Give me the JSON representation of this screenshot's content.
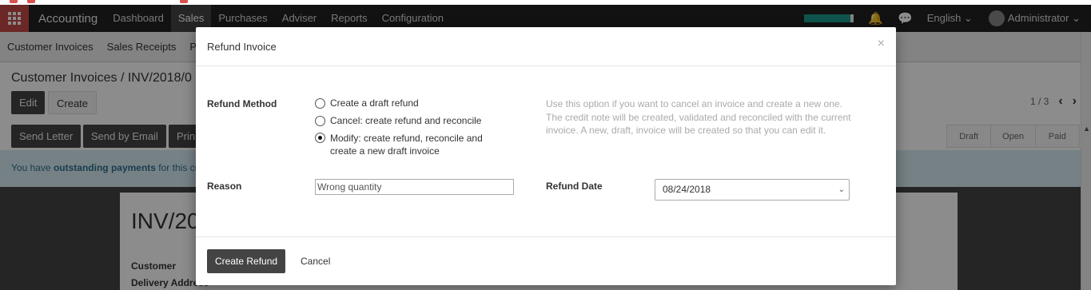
{
  "navbar": {
    "brand": "Accounting",
    "items": [
      "Dashboard",
      "Sales",
      "Purchases",
      "Adviser",
      "Reports",
      "Configuration"
    ],
    "active": "Sales",
    "language": "English",
    "user": "Administrator"
  },
  "subnav": {
    "items": [
      "Customer Invoices",
      "Sales Receipts",
      "Pa"
    ]
  },
  "control_panel": {
    "breadcrumb": "Customer Invoices / INV/2018/0",
    "edit_label": "Edit",
    "create_label": "Create",
    "pager": "1 / 3"
  },
  "actions": {
    "send_letter": "Send Letter",
    "send_email": "Send by Email",
    "print": "Prin"
  },
  "status": [
    "Draft",
    "Open",
    "Paid"
  ],
  "alert": {
    "prefix": "You have ",
    "strong": "outstanding payments",
    "suffix": " for this cu"
  },
  "sheet": {
    "title": "INV/20",
    "customer_label": "Customer",
    "delivery_label": "Delivery Address"
  },
  "modal": {
    "title": "Refund Invoice",
    "close": "×",
    "refund_method_label": "Refund Method",
    "options": [
      {
        "label": "Create a draft refund",
        "checked": false
      },
      {
        "label": "Cancel: create refund and reconcile",
        "checked": false
      },
      {
        "label": "Modify: create refund, reconcile and create a new draft invoice",
        "checked": true
      }
    ],
    "help": "Use this option if you want to cancel an invoice and create a new one. The credit note will be created, validated and reconciled with the current invoice. A new, draft, invoice will be created so that you can edit it.",
    "reason_label": "Reason",
    "reason_value": "Wrong quantity",
    "refund_date_label": "Refund Date",
    "refund_date_value": "08/24/2018",
    "create_refund": "Create Refund",
    "cancel": "Cancel"
  }
}
